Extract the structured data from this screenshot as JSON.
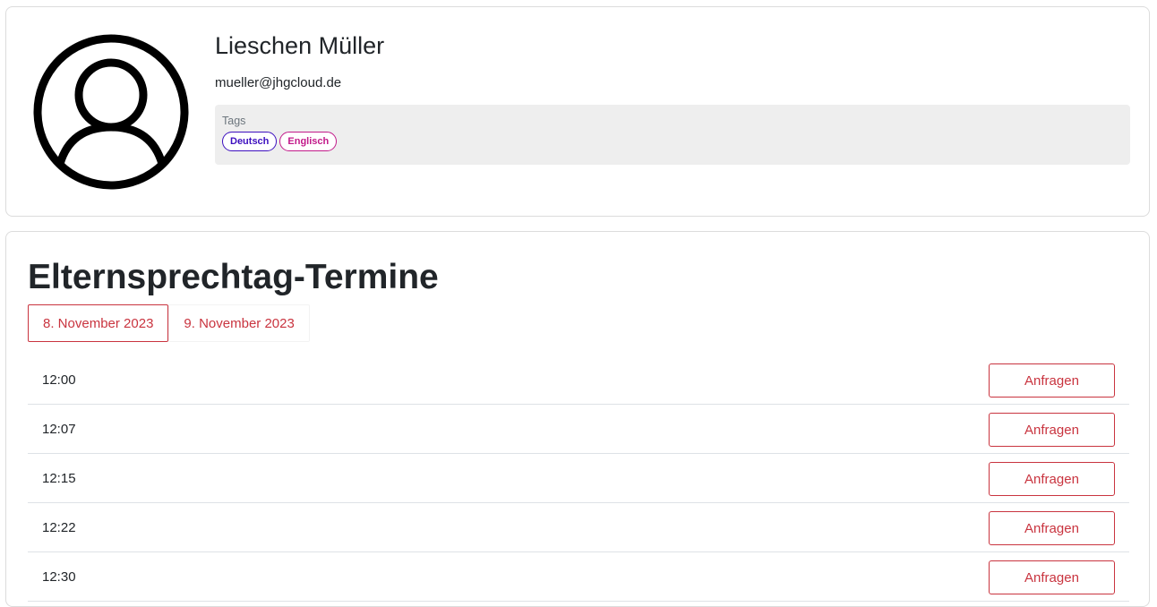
{
  "profile": {
    "avatar_icon": "user-circle-icon",
    "name": "Lieschen Müller",
    "email": "mueller@jhgcloud.de",
    "tags_label": "Tags",
    "tags": [
      {
        "label": "Deutsch",
        "color": "#3d0fbf"
      },
      {
        "label": "Englisch",
        "color": "#c21a8a"
      }
    ]
  },
  "appointments": {
    "title": "Elternsprechtag-Termine",
    "accent_color": "#c9343f",
    "date_tabs": [
      {
        "label": "8. November 2023",
        "active": true
      },
      {
        "label": "9. November 2023",
        "active": false
      }
    ],
    "slots": [
      {
        "time": "12:00",
        "action": "Anfragen"
      },
      {
        "time": "12:07",
        "action": "Anfragen"
      },
      {
        "time": "12:15",
        "action": "Anfragen"
      },
      {
        "time": "12:22",
        "action": "Anfragen"
      },
      {
        "time": "12:30",
        "action": "Anfragen"
      }
    ]
  }
}
